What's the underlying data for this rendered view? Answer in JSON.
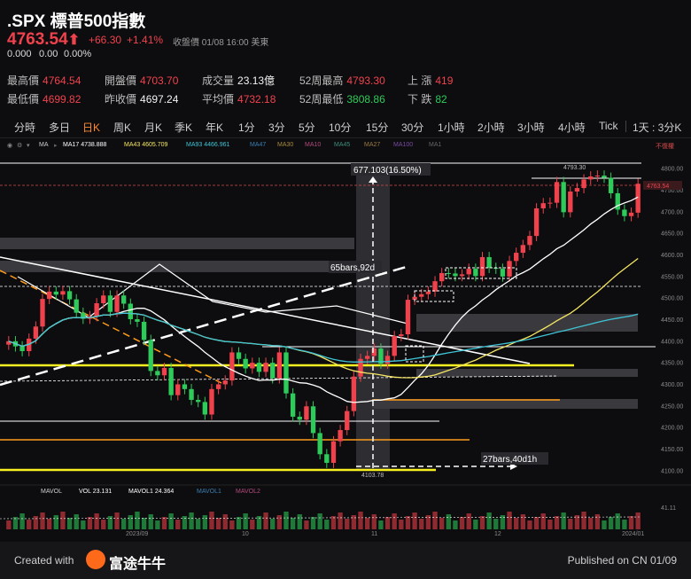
{
  "header": {
    "symbol": ".SPX",
    "name": "標普500指數",
    "price": "4763.54",
    "change": "+66.30",
    "change_pct": "+1.41%",
    "status": "收盤價 01/08 16:00 美東",
    "after_price": "0.000",
    "after_change": "0.00",
    "after_pct": "0.00%"
  },
  "stats": [
    {
      "label": "最高價",
      "value": "4764.54",
      "color": "red"
    },
    {
      "label": "開盤價",
      "value": "4703.70",
      "color": "red"
    },
    {
      "label": "成交量",
      "value": "23.13億",
      "color": "white"
    },
    {
      "label": "52周最高",
      "value": "4793.30",
      "color": "red"
    },
    {
      "label": "上 漲",
      "value": "419",
      "color": "red"
    },
    {
      "label": "最低價",
      "value": "4699.82",
      "color": "red"
    },
    {
      "label": "昨收價",
      "value": "4697.24",
      "color": "white"
    },
    {
      "label": "平均價",
      "value": "4732.18",
      "color": "red"
    },
    {
      "label": "52周最低",
      "value": "3808.86",
      "color": "green"
    },
    {
      "label": "下 跌",
      "value": "82",
      "color": "green"
    }
  ],
  "tabs": [
    "分時",
    "多日",
    "日K",
    "周K",
    "月K",
    "季K",
    "年K",
    "1分",
    "3分",
    "5分",
    "10分",
    "15分",
    "30分",
    "1小時",
    "2小時",
    "3小時",
    "4小時",
    "Tick",
    "1天 : 3分K"
  ],
  "active_tab": "日K",
  "ma_legend": [
    {
      "label": "MA",
      "color": "#cfcfcf"
    },
    {
      "label": "MA17  4738.888",
      "color": "#ffffff"
    },
    {
      "label": "MA43  4605.709",
      "color": "#f5e663"
    },
    {
      "label": "MA93  4466.961",
      "color": "#3fc4d6"
    },
    {
      "label": "MA47",
      "color": "#3a7fb0"
    },
    {
      "label": "MA30",
      "color": "#a88a3a"
    },
    {
      "label": "MA10",
      "color": "#b04a7a"
    },
    {
      "label": "MA45",
      "color": "#3e8e7a"
    },
    {
      "label": "MA27",
      "color": "#9a7a40"
    },
    {
      "label": "MA100",
      "color": "#7a4aa0"
    },
    {
      "label": "MA1",
      "color": "#888888"
    }
  ],
  "no_adjust": "不復權",
  "annotations": {
    "range_label": "677.103(16.50%)",
    "bars1": "65bars,92d",
    "bars2": "27bars,40d1h",
    "high_mark": "4793.30",
    "low_mark": "4103.78",
    "last_tag": "4763.54"
  },
  "price_axis": [
    "4800.00",
    "4750.00",
    "4700.00",
    "4650.00",
    "4600.00",
    "4550.00",
    "4500.00",
    "4450.00",
    "4400.00",
    "4350.00",
    "4300.00",
    "4250.00",
    "4200.00",
    "4150.00",
    "4100.00"
  ],
  "volume": {
    "mavol": "MAVOL",
    "vol": "VOL  23.131",
    "mavol1": "MAVOL1  24.364",
    "mavol1_dim": "MAVOL1",
    "mavol2": "MAVOL2",
    "axis_top": "41.11"
  },
  "date_axis": [
    "2023/09",
    "10",
    "11",
    "12",
    "2024/01"
  ],
  "footer": {
    "created": "Created with",
    "brand": "富途牛牛",
    "published": "Published on CN 01/09"
  },
  "chart_data": {
    "type": "candlestick",
    "ylim": [
      4080,
      4820
    ],
    "x": [
      "2023-08-21",
      "2024-01-08"
    ],
    "close": [
      4399,
      4387,
      4376,
      4405,
      4433,
      4497,
      4514,
      4507,
      4515,
      4496,
      4465,
      4451,
      4457,
      4487,
      4505,
      4467,
      4505,
      4486,
      4450,
      4444,
      4402,
      4330,
      4320,
      4337,
      4274,
      4299,
      4288,
      4263,
      4258,
      4229,
      4288,
      4299,
      4308,
      4373,
      4358,
      4336,
      4349,
      4328,
      4349,
      4313,
      4373,
      4278,
      4224,
      4217,
      4248,
      4186,
      4137,
      4117,
      4167,
      4193,
      4237,
      4317,
      4358,
      4365,
      4382,
      4347,
      4365,
      4411,
      4415,
      4495,
      4502,
      4508,
      4514,
      4538,
      4557,
      4556,
      4550,
      4554,
      4567,
      4550,
      4594,
      4569,
      4567,
      4549,
      4585,
      4604,
      4622,
      4643,
      4707,
      4719,
      4720,
      4768,
      4698,
      4746,
      4754,
      4774,
      4781,
      4783,
      4778,
      4742,
      4704,
      4689,
      4697,
      4764
    ]
  }
}
